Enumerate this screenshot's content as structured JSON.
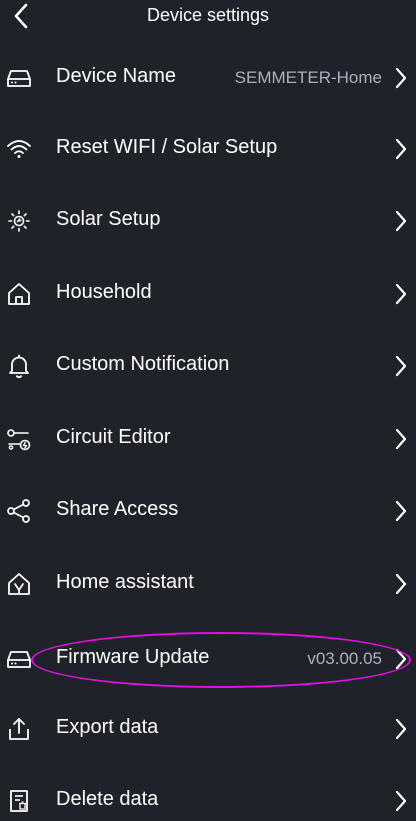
{
  "header": {
    "title": "Device settings"
  },
  "items": [
    {
      "label": "Device Name",
      "value": "SEMMETER-Home",
      "icon": "router-icon"
    },
    {
      "label": "Reset WIFI / Solar Setup",
      "value": "",
      "icon": "wifi-icon"
    },
    {
      "label": "Solar Setup",
      "value": "",
      "icon": "sun-icon"
    },
    {
      "label": "Household",
      "value": "",
      "icon": "home-icon"
    },
    {
      "label": "Custom Notification",
      "value": "",
      "icon": "bell-icon"
    },
    {
      "label": "Circuit Editor",
      "value": "",
      "icon": "circuit-icon"
    },
    {
      "label": "Share Access",
      "value": "",
      "icon": "share-icon"
    },
    {
      "label": "Home assistant",
      "value": "",
      "icon": "home-assistant-icon"
    },
    {
      "label": "Firmware Update",
      "value": "v03.00.05",
      "icon": "router-icon"
    },
    {
      "label": "Export data",
      "value": "",
      "icon": "export-icon"
    },
    {
      "label": "Delete data",
      "value": "",
      "icon": "delete-data-icon"
    }
  ],
  "annotation": {
    "highlighted_item": "Firmware Update",
    "color": "#e00ee0"
  }
}
